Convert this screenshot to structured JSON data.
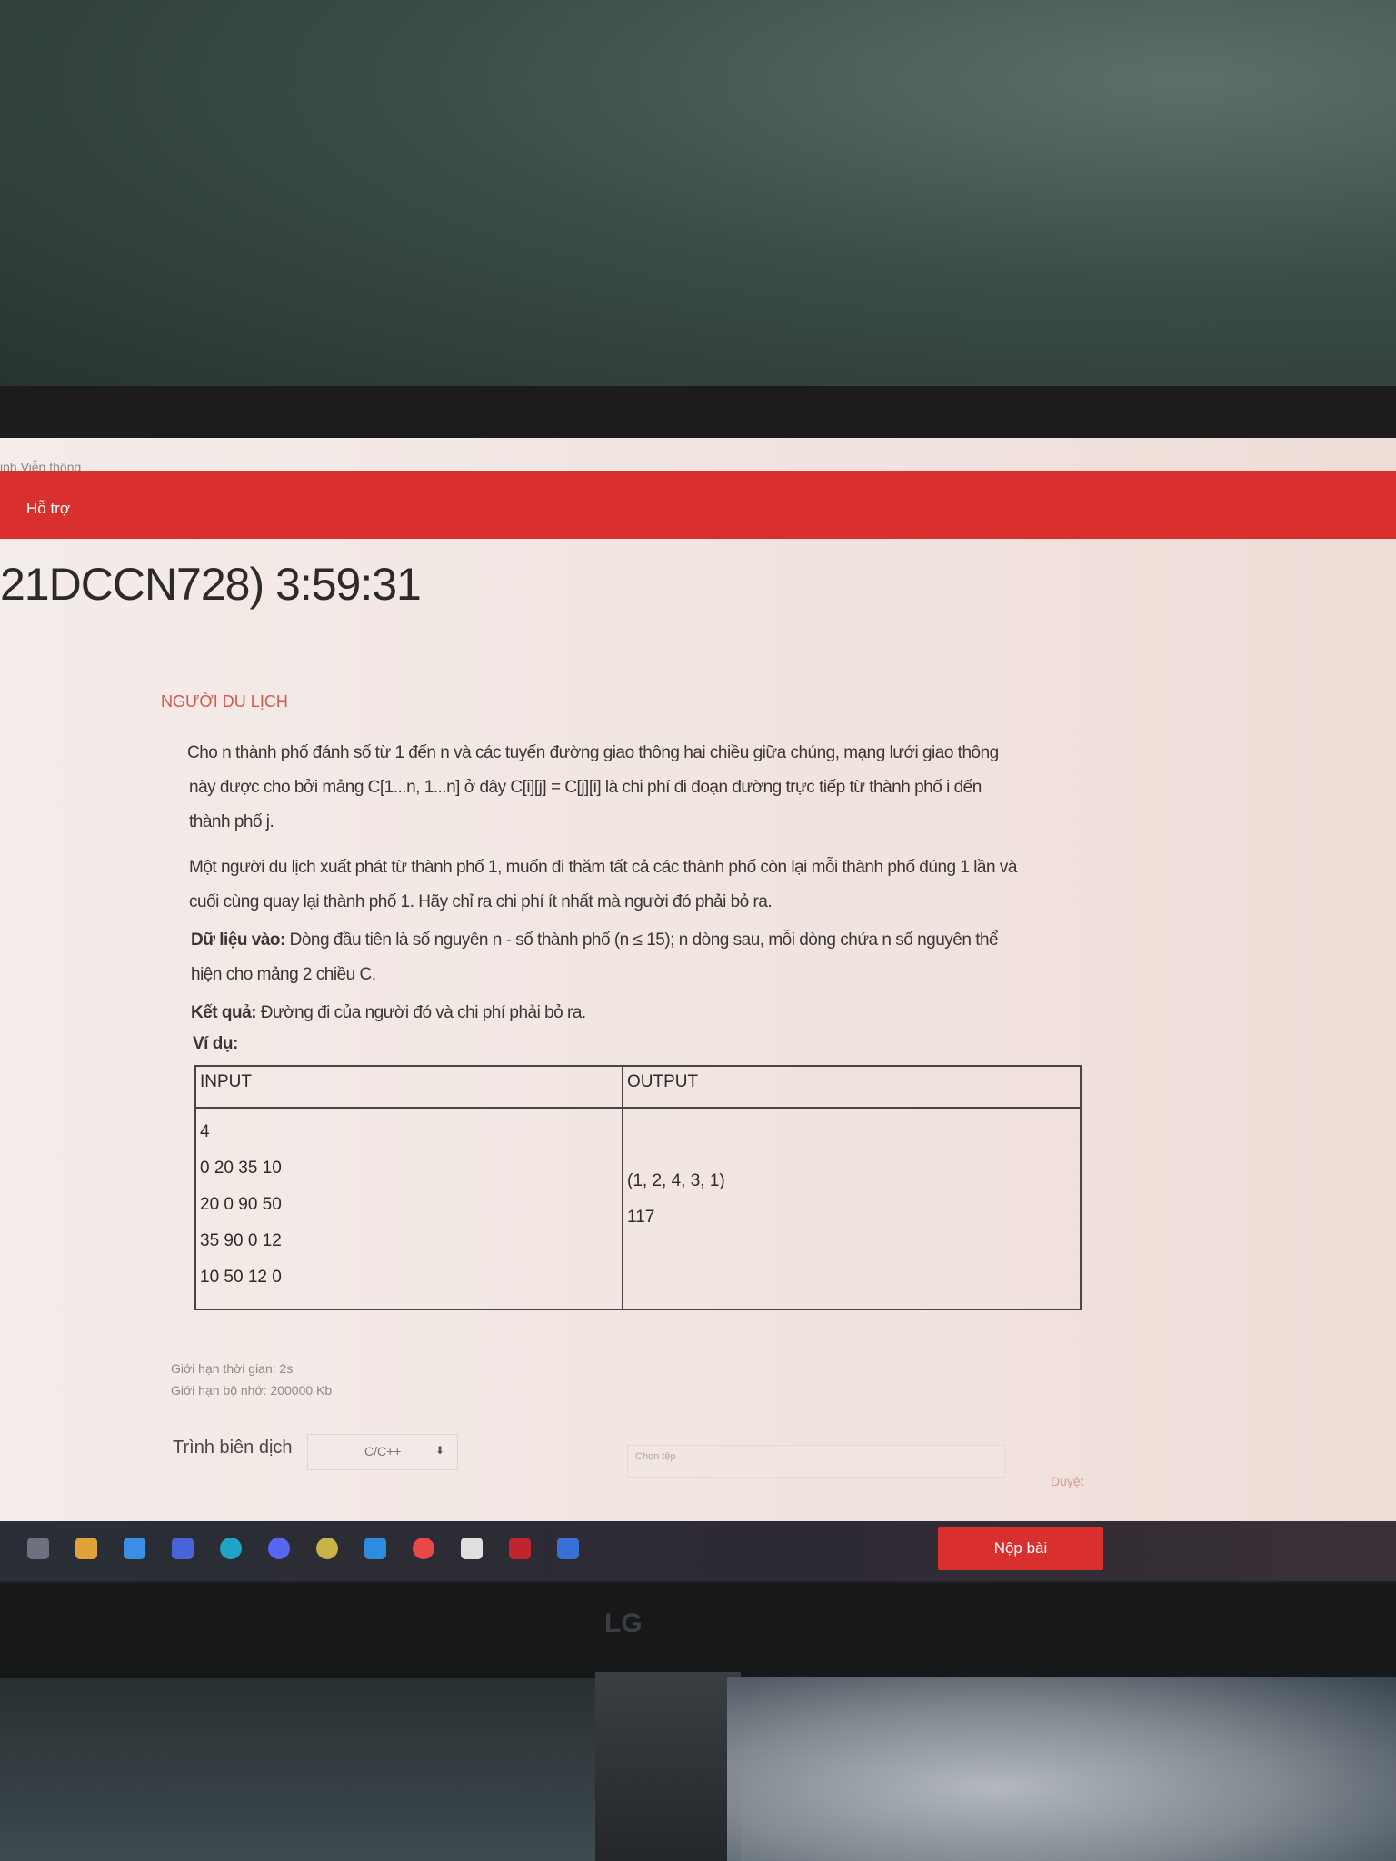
{
  "header": {
    "site_name": "ịnh Viễn thông",
    "support_link": "Hỗ trợ"
  },
  "exam": {
    "timer_text": "21DCCN728) 3:59:31"
  },
  "problem": {
    "title": "NGƯỜI DU LỊCH",
    "paragraph_lines": [
      "Cho n thành phố đánh số từ 1 đến n và các tuyến đường giao thông hai chiều giữa chúng, mạng lưới giao thông",
      "này được cho bởi mảng C[1...n, 1...n] ở đây C[i][j] = C[j][i] là chi phí đi đoạn đường trực tiếp từ thành phố i đến",
      "thành phố j.",
      "Một người du lịch xuất phát từ thành phố 1, muốn đi thăm tất cả các thành phố còn lại mỗi thành phố đúng 1 lần và",
      "cuối cùng quay lại thành phố 1. Hãy chỉ ra chi phí ít nhất mà người đó phải bỏ ra."
    ],
    "input_label": "Dữ liệu vào:",
    "input_line1": " Dòng đầu tiên là số nguyên n - số thành phố (n ≤ 15); n dòng sau, mỗi dòng chứa n số nguyên thể",
    "input_line2": "hiện cho mảng 2 chiều C.",
    "output_label": "Kết quả:",
    "output_text": " Đường đi của người đó và chi phí phải bỏ ra.",
    "example_label": "Ví dụ:",
    "table": {
      "headers": [
        "INPUT",
        "OUTPUT"
      ],
      "input_lines": [
        "4",
        "0 20 35 10",
        "20 0 90 50",
        "35 90 0 12",
        "10 50 12 0"
      ],
      "output_lines": [
        "(1, 2, 4, 3, 1)",
        "117"
      ]
    },
    "time_limit": "Giới hạn thời gian: 2s",
    "memory_limit": "Giới hạn bộ nhớ: 200000 Kb"
  },
  "submission": {
    "compiler_label": "Trình biên dịch",
    "compiler_value": "C/C++",
    "file_placeholder": "Chọn tệp",
    "browse_label": "Duyệt",
    "submit_label": "Nộp bài"
  },
  "monitor": {
    "brand": "LG"
  },
  "taskbar": {
    "icons": [
      "task-view-icon",
      "file-explorer-icon",
      "mail-icon",
      "store-icon",
      "edge-icon",
      "discord-icon",
      "chrome-icon",
      "vscode-icon",
      "app-red-icon",
      "check-app-icon",
      "active-app-icon",
      "app-blue-icon"
    ],
    "colors": [
      "#6e7280",
      "#e0a23a",
      "#3b8ee5",
      "#4b63d8",
      "#1fa4c8",
      "#5865f2",
      "#c9b347",
      "#2c8de0",
      "#e84848",
      "#e0e0e0",
      "#c0242c",
      "#3a6fd6"
    ]
  }
}
